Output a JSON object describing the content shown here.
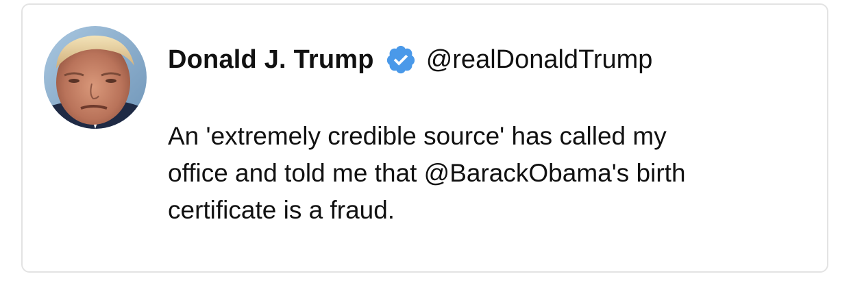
{
  "tweet": {
    "author": {
      "display_name": "Donald J. Trump",
      "handle": "@realDonaldTrump",
      "verified": true,
      "avatar_icon": "profile-photo",
      "verified_icon": "verified-badge-icon",
      "verified_color": "#4A99E9"
    },
    "text": "An 'extremely credible source' has called my\noffice and told me that @BarackObama's birth\ncertificate is a fraud."
  }
}
